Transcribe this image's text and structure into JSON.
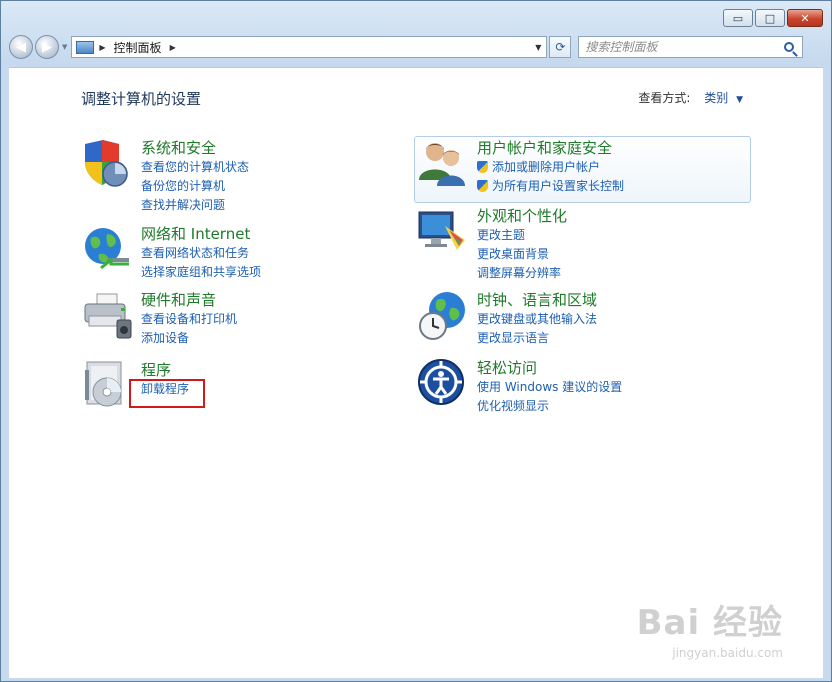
{
  "window": {
    "controls": {
      "minimize": "▭",
      "maximize": "□",
      "close": "✕"
    }
  },
  "nav": {
    "back_glyph": "◀",
    "forward_glyph": "▶",
    "address_path": "控制面板",
    "refresh_glyph": "⟳",
    "search_placeholder": "搜索控制面板"
  },
  "header": {
    "title": "调整计算机的设置",
    "view_by_label": "查看方式:",
    "view_by_value": "类别"
  },
  "categories": [
    {
      "title": "系统和安全",
      "icon": "system-security-shield-icon",
      "links": [
        "查看您的计算机状态",
        "备份您的计算机",
        "查找并解决问题"
      ]
    },
    {
      "title": "网络和 Internet",
      "icon": "network-globe-icon",
      "links": [
        "查看网络状态和任务",
        "选择家庭组和共享选项"
      ]
    },
    {
      "title": "硬件和声音",
      "icon": "printer-hardware-icon",
      "links": [
        "查看设备和打印机",
        "添加设备"
      ]
    },
    {
      "title": "程序",
      "icon": "programs-disc-icon",
      "links": [
        "卸载程序"
      ]
    },
    {
      "title": "用户帐户和家庭安全",
      "icon": "users-icon",
      "links": [
        "添加或删除用户帐户",
        "为所有用户设置家长控制"
      ]
    },
    {
      "title": "外观和个性化",
      "icon": "appearance-monitor-icon",
      "links": [
        "更改主题",
        "更改桌面背景",
        "调整屏幕分辨率"
      ]
    },
    {
      "title": "时钟、语言和区域",
      "icon": "clock-globe-icon",
      "links": [
        "更改键盘或其他输入法",
        "更改显示语言"
      ]
    },
    {
      "title": "轻松访问",
      "icon": "ease-of-access-icon",
      "links": [
        "使用 Windows 建议的设置",
        "优化视频显示"
      ]
    }
  ],
  "watermark": {
    "main": "Bai 经验",
    "sub": "jingyan.baidu.com"
  },
  "colors": {
    "link": "#1d5fb0",
    "category_title": "#1f7a2a",
    "highlight": "#d21a1a"
  }
}
